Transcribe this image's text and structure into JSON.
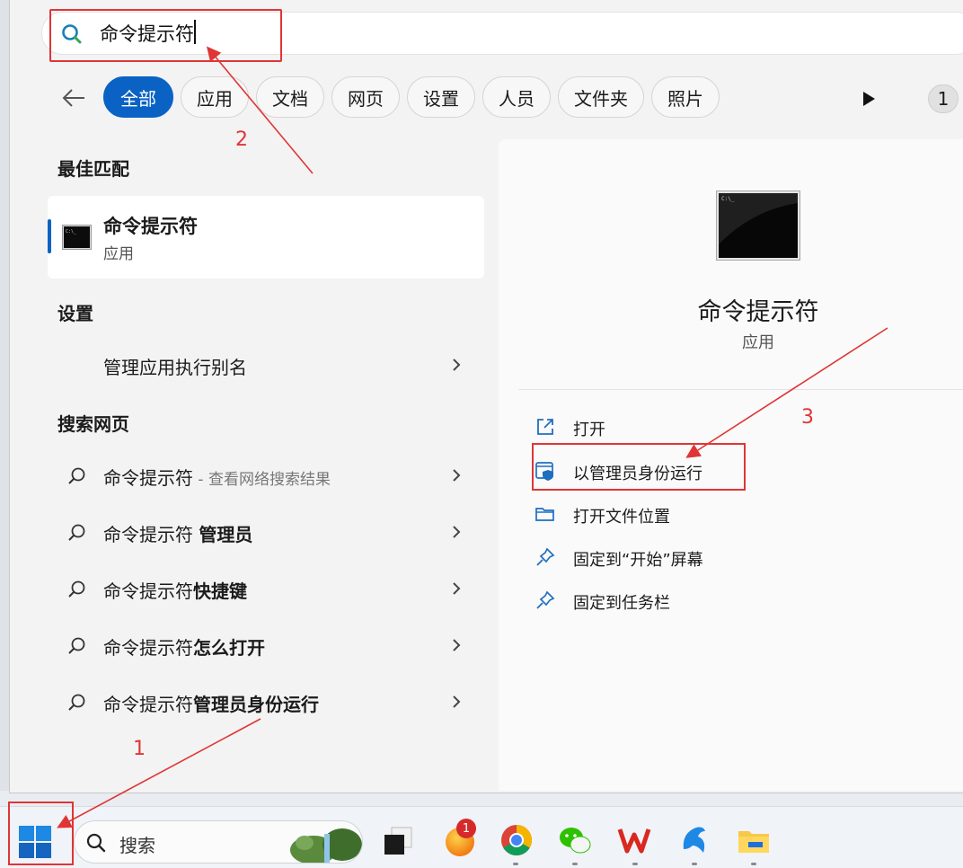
{
  "search": {
    "value": "命令提示符"
  },
  "filters": {
    "back_icon": "back-arrow-icon",
    "items": [
      "全部",
      "应用",
      "文档",
      "网页",
      "设置",
      "人员",
      "文件夹",
      "照片"
    ],
    "count_badge": "1"
  },
  "best_match": {
    "heading": "最佳匹配",
    "title": "命令提示符",
    "subtitle": "应用"
  },
  "settings": {
    "heading": "设置",
    "item": "管理应用执行别名"
  },
  "web": {
    "heading": "搜索网页",
    "items": [
      {
        "plain": "命令提示符",
        "bold": "",
        "muted": " - 查看网络搜索结果"
      },
      {
        "plain": "命令提示符 ",
        "bold": "管理员",
        "muted": ""
      },
      {
        "plain": "命令提示符",
        "bold": "快捷键",
        "muted": ""
      },
      {
        "plain": "命令提示符",
        "bold": "怎么打开",
        "muted": ""
      },
      {
        "plain": "命令提示符",
        "bold": "管理员身份运行",
        "muted": ""
      }
    ]
  },
  "detail": {
    "title": "命令提示符",
    "subtitle": "应用",
    "actions": [
      {
        "label": "打开",
        "icon": "open-external-icon"
      },
      {
        "label": "以管理员身份运行",
        "icon": "admin-shield-icon"
      },
      {
        "label": "打开文件位置",
        "icon": "folder-icon"
      },
      {
        "label": "固定到“开始”屏幕",
        "icon": "pin-icon"
      },
      {
        "label": "固定到任务栏",
        "icon": "pin-icon"
      }
    ]
  },
  "annotations": {
    "one": "1",
    "two": "2",
    "three": "3"
  },
  "taskbar": {
    "search_label": "搜索",
    "notification_count": "1"
  },
  "colors": {
    "accent": "#0a62c4",
    "annotation": "#e03535"
  }
}
